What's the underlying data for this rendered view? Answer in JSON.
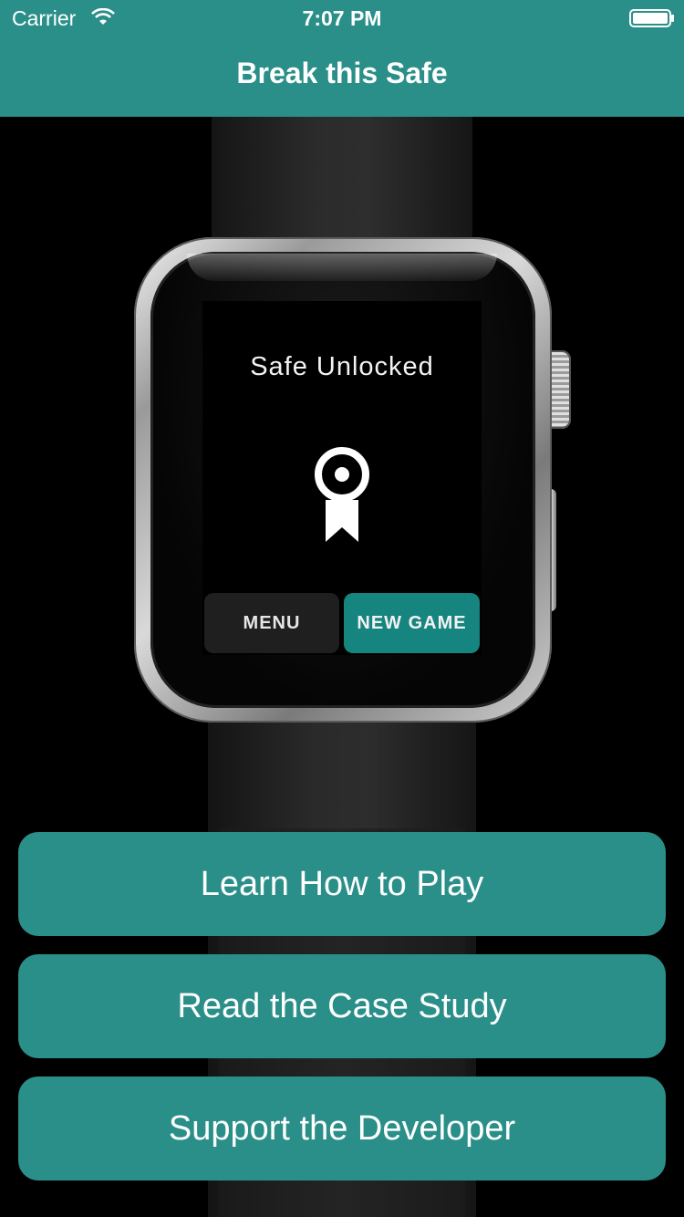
{
  "status_bar": {
    "carrier": "Carrier",
    "time": "7:07 PM",
    "wifi_icon": "wifi-icon",
    "battery_icon": "battery-icon"
  },
  "nav": {
    "title": "Break this Safe"
  },
  "watch": {
    "status": "Safe Unlocked",
    "icon": "award-ribbon-icon",
    "menu_label": "MENU",
    "new_game_label": "NEW GAME"
  },
  "buttons": {
    "learn": "Learn How to Play",
    "case_study": "Read the Case Study",
    "support": "Support the Developer"
  },
  "colors": {
    "accent": "#2b8f89",
    "watch_accent": "#16857f",
    "background": "#000000"
  }
}
